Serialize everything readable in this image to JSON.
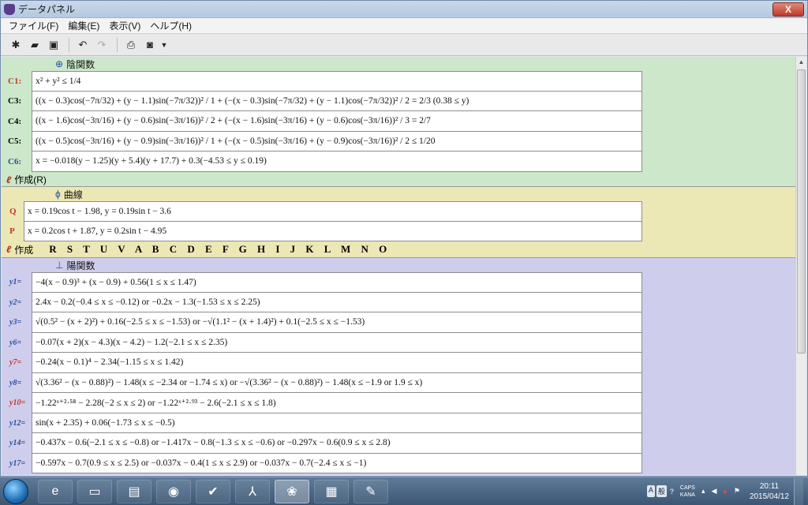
{
  "window": {
    "title": "データパネル",
    "close_label": "X"
  },
  "menu": [
    "ファイル(F)",
    "編集(E)",
    "表示(V)",
    "ヘルプ(H)"
  ],
  "toolbar_icons": [
    "new-icon",
    "open-folder-icon",
    "save-icon",
    "undo-icon",
    "redo-icon",
    "print-icon",
    "camera-icon",
    "dropdown-arrow-icon"
  ],
  "sections": {
    "implicit": {
      "title": "陰関数",
      "color": "#cce7c9",
      "rows": [
        {
          "label": "C1:",
          "label_color": "#c0392b",
          "expr": "x² + y² ≤ 1/4"
        },
        {
          "label": "C3:",
          "label_color": "#111111",
          "expr": "((x − 0.3)cos(−7π/32) + (y − 1.1)sin(−7π/32))² / 1 + (−(x − 0.3)sin(−7π/32) + (y − 1.1)cos(−7π/32))² / 2 = 2/3 (0.38 ≤ y)"
        },
        {
          "label": "C4:",
          "label_color": "#111111",
          "expr": "((x − 1.6)cos(−3π/16) + (y − 0.6)sin(−3π/16))² / 2 + (−(x − 1.6)sin(−3π/16) + (y − 0.6)cos(−3π/16))² / 3 = 2/7"
        },
        {
          "label": "C5:",
          "label_color": "#111111",
          "expr": "((x − 0.5)cos(−3π/16) + (y − 0.9)sin(−3π/16))² / 1 + (−(x − 0.5)sin(−3π/16) + (y − 0.9)cos(−3π/16))² / 2 ≤ 1/20"
        },
        {
          "label": "C6:",
          "label_color": "#2a4fa0",
          "expr": "x = −0.018(y − 1.25)(y + 5.4)(y + 17.7) + 0.3(−4.53 ≤ y ≤ 0.19)"
        }
      ],
      "make_label": "作成(R)"
    },
    "curve": {
      "title": "曲線",
      "color": "#ece8b6",
      "rows": [
        {
          "label": "Q",
          "label_color": "#c0392b",
          "expr": "x = 0.19cos t − 1.98, y = 0.19sin t − 3.6"
        },
        {
          "label": "P",
          "label_color": "#c0392b",
          "expr": "x = 0.2cos t + 1.87, y = 0.2sin t − 4.95"
        }
      ],
      "make_label": "作成",
      "letters": "R S T U V A B C D E F G H I J K L M N O"
    },
    "explicit": {
      "title": "陽関数",
      "color": "#cfcdec",
      "rows": [
        {
          "label": "y1=",
          "label_color": "#2a4fa0",
          "expr": "−4(x − 0.9)³ + (x − 0.9) + 0.56(1 ≤ x ≤ 1.47)"
        },
        {
          "label": "y2=",
          "label_color": "#2a4fa0",
          "expr": "2.4x − 0.2(−0.4 ≤ x ≤ −0.12) or −0.2x − 1.3(−1.53 ≤ x ≤ 2.25)"
        },
        {
          "label": "y3=",
          "label_color": "#2a4fa0",
          "expr": "√(0.5² − (x + 2)²) + 0.16(−2.5 ≤ x ≤ −1.53) or −√(1.1² − (x + 1.4)²) + 0.1(−2.5 ≤ x ≤ −1.53)"
        },
        {
          "label": "y6=",
          "label_color": "#2a4fa0",
          "expr": "−0.07(x + 2)(x − 4.3)(x − 4.2) − 1.2(−2.1 ≤ x ≤ 2.35)"
        },
        {
          "label": "y7=",
          "label_color": "#c0392b",
          "expr": "−0.24(x − 0.1)⁴ − 2.34(−1.15 ≤ x ≤ 1.42)"
        },
        {
          "label": "y8=",
          "label_color": "#2a4fa0",
          "expr": "√(3.36² − (x − 0.88)²) − 1.48(x ≤ −2.34 or −1.74 ≤ x) or −√(3.36² − (x − 0.88)²) − 1.48(x ≤ −1.9 or 1.9 ≤ x)"
        },
        {
          "label": "y10=",
          "label_color": "#c0392b",
          "expr": "−1.22ˣ⁺²·⁵⁸ − 2.28(−2 ≤ x ≤ 2) or −1.22ˣ⁺²·⁹³ − 2.6(−2.1 ≤ x ≤ 1.8)"
        },
        {
          "label": "y12=",
          "label_color": "#2a4fa0",
          "expr": "sin(x + 2.35) + 0.06(−1.73 ≤ x ≤ −0.5)"
        },
        {
          "label": "y14=",
          "label_color": "#2a4fa0",
          "expr": "−0.437x − 0.6(−2.1 ≤ x ≤ −0.8) or −1.417x − 0.8(−1.3 ≤ x ≤ −0.6) or −0.297x − 0.6(0.9 ≤ x ≤ 2.8)"
        },
        {
          "label": "y17=",
          "label_color": "#2a4fa0",
          "expr": "−0.597x − 0.7(0.9 ≤ x ≤ 2.5) or −0.037x − 0.4(1 ≤ x ≤ 2.9) or −0.037x − 0.7(−2.4 ≤ x ≤ −1)"
        }
      ]
    }
  },
  "taskbar": {
    "apps": [
      "ie-icon",
      "explorer-icon",
      "powerpoint-icon",
      "firefox-icon",
      "tasks-icon",
      "acrobat-icon",
      "grape-app-icon",
      "photos-icon",
      "paint-icon"
    ],
    "active_app": "grape-app-icon",
    "ime_labels": [
      "A",
      "般"
    ],
    "caps_label": "CAPS",
    "kana_label": "KANA",
    "time": "20:11",
    "date": "2015/04/12"
  }
}
